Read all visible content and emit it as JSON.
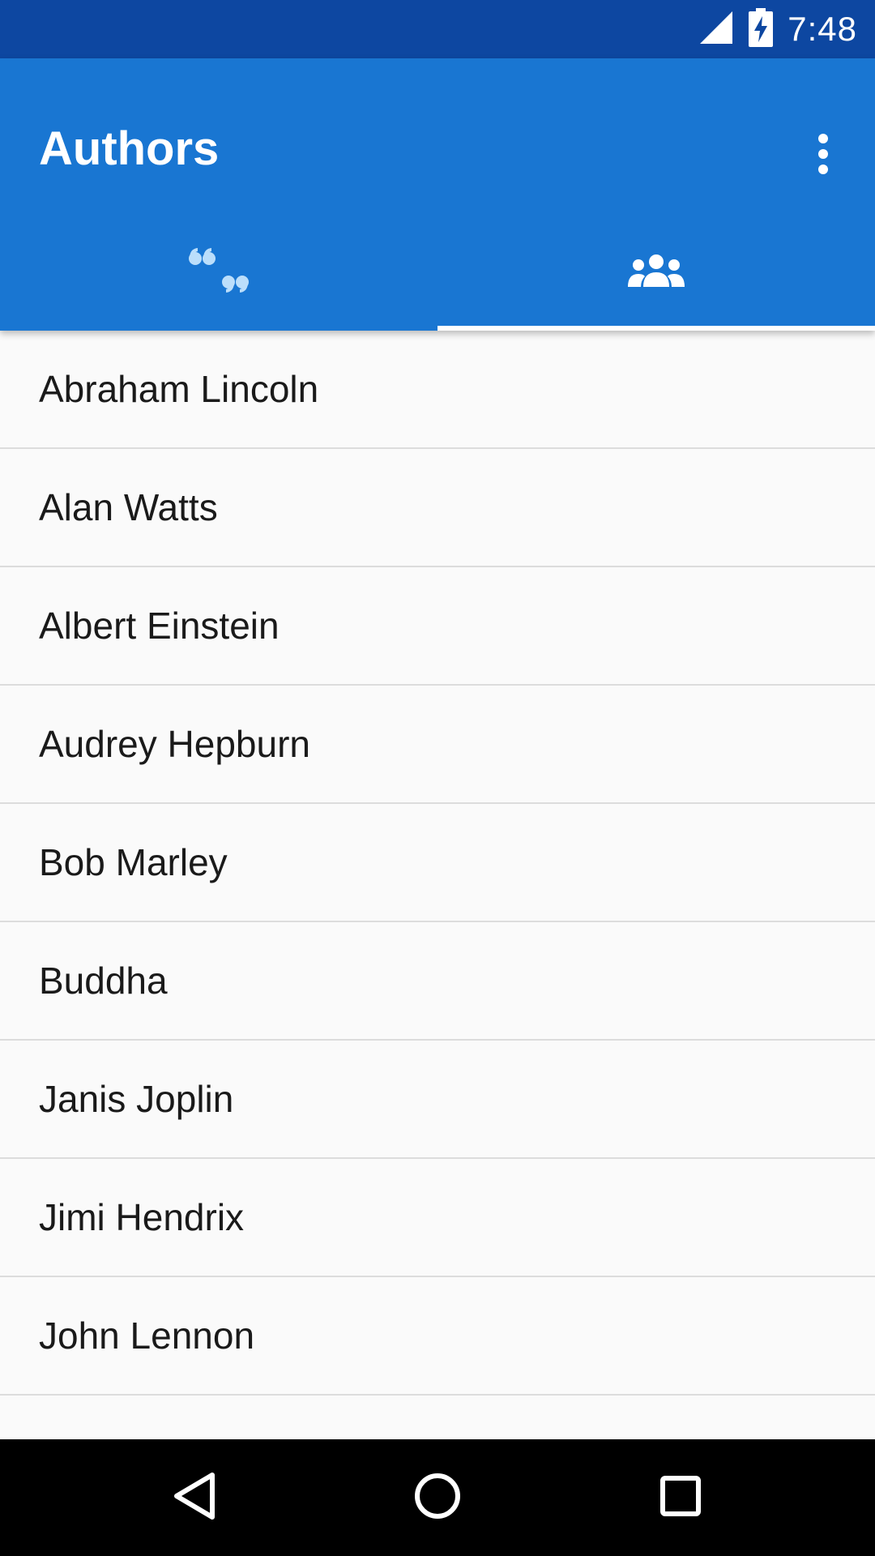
{
  "status_bar": {
    "time": "7:48",
    "icons": [
      "signal-icon",
      "battery-charging-icon"
    ]
  },
  "app_bar": {
    "title": "Authors",
    "overflow_icon": "more-vert-icon"
  },
  "tabs": [
    {
      "icon": "format-quote-icon",
      "selected": false
    },
    {
      "icon": "people-icon",
      "selected": true
    }
  ],
  "authors": [
    {
      "name": "Abraham Lincoln"
    },
    {
      "name": "Alan Watts"
    },
    {
      "name": "Albert Einstein"
    },
    {
      "name": "Audrey Hepburn"
    },
    {
      "name": "Bob Marley"
    },
    {
      "name": "Buddha"
    },
    {
      "name": "Janis Joplin"
    },
    {
      "name": "Jimi Hendrix"
    },
    {
      "name": "John Lennon"
    }
  ],
  "nav_bar": {
    "buttons": [
      "back-icon",
      "home-icon",
      "recents-icon"
    ]
  },
  "colors": {
    "status_bar": "#0d47a1",
    "primary": "#1976d2",
    "tab_inactive": "#bbdefb",
    "background": "#fafafa"
  }
}
